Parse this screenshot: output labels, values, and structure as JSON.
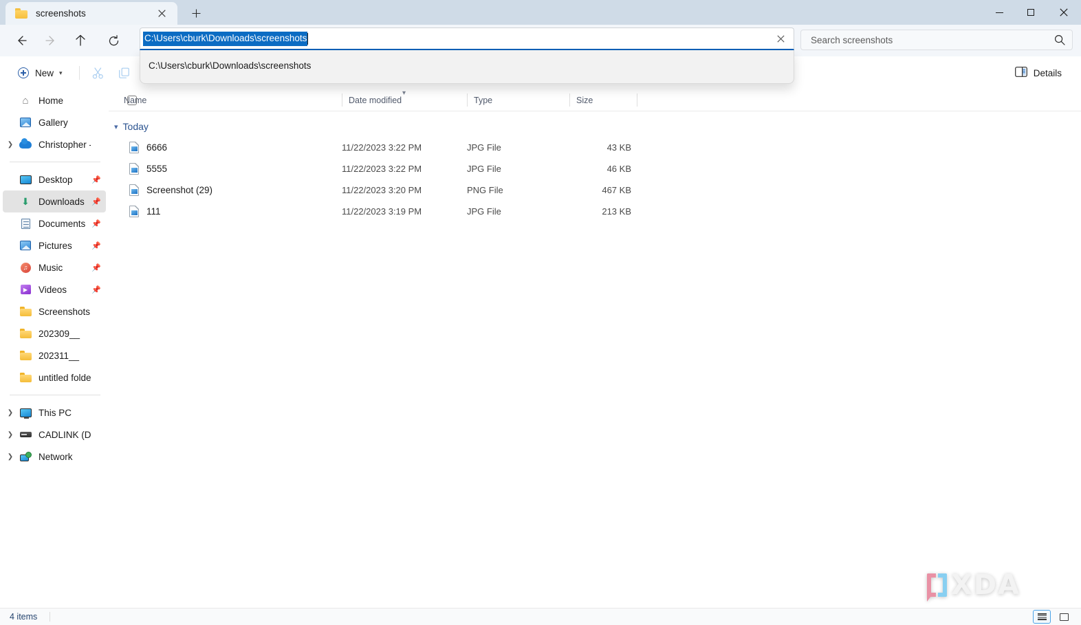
{
  "window": {
    "tab_title": "screenshots",
    "tab_close_icon": "close-icon",
    "new_tab_icon": "plus-icon",
    "minimize_icon": "minimize-icon",
    "maximize_icon": "maximize-icon",
    "close_icon": "close-icon"
  },
  "nav": {
    "back_icon": "arrow-left-icon",
    "forward_icon": "arrow-right-icon",
    "up_icon": "arrow-up-icon",
    "refresh_icon": "refresh-icon"
  },
  "address": {
    "value": "C:\\Users\\cburk\\Downloads\\screenshots",
    "selected": true,
    "clear_icon": "close-icon",
    "selection_color": "#0c6cc3",
    "underline_color": "#005fb8",
    "suggestions": [
      "C:\\Users\\cburk\\Downloads\\screenshots"
    ]
  },
  "search": {
    "placeholder": "Search screenshots",
    "icon": "search-icon"
  },
  "toolbar": {
    "new_label": "New",
    "new_icon": "plus-circle-icon",
    "new_chevron": "chevron-down-icon",
    "cut_icon": "scissors-icon",
    "copy_icon": "copy-icon",
    "details_label": "Details",
    "details_icon": "details-pane-icon"
  },
  "sidebar": {
    "items": [
      {
        "label": "Home",
        "icon": "home-icon",
        "type": "home",
        "expand": false,
        "pin": false,
        "selected": false
      },
      {
        "label": "Gallery",
        "icon": "gallery-icon",
        "type": "image",
        "expand": false,
        "pin": false,
        "selected": false
      },
      {
        "label": "Christopher - Perso",
        "icon": "onedrive-icon",
        "type": "cloud",
        "expand": true,
        "pin": false,
        "selected": false
      },
      {
        "separator": true
      },
      {
        "label": "Desktop",
        "icon": "desktop-icon",
        "type": "desktop",
        "expand": false,
        "pin": true,
        "selected": false
      },
      {
        "label": "Downloads",
        "icon": "downloads-icon",
        "type": "down",
        "expand": false,
        "pin": true,
        "selected": true
      },
      {
        "label": "Documents",
        "icon": "documents-icon",
        "type": "doc",
        "expand": false,
        "pin": true,
        "selected": false
      },
      {
        "label": "Pictures",
        "icon": "pictures-icon",
        "type": "image",
        "expand": false,
        "pin": true,
        "selected": false
      },
      {
        "label": "Music",
        "icon": "music-icon",
        "type": "music",
        "expand": false,
        "pin": true,
        "selected": false
      },
      {
        "label": "Videos",
        "icon": "videos-icon",
        "type": "video",
        "expand": false,
        "pin": true,
        "selected": false
      },
      {
        "label": "Screenshots",
        "icon": "folder-icon",
        "type": "folder",
        "expand": false,
        "pin": false,
        "selected": false
      },
      {
        "label": "202309__",
        "icon": "folder-icon",
        "type": "folder",
        "expand": false,
        "pin": false,
        "selected": false
      },
      {
        "label": "202311__",
        "icon": "folder-icon",
        "type": "folder",
        "expand": false,
        "pin": false,
        "selected": false
      },
      {
        "label": "untitled folder",
        "icon": "folder-icon",
        "type": "folder",
        "expand": false,
        "pin": false,
        "selected": false
      },
      {
        "separator": true
      },
      {
        "label": "This PC",
        "icon": "this-pc-icon",
        "type": "pc",
        "expand": true,
        "pin": false,
        "selected": false
      },
      {
        "label": "CADLINK (D:)",
        "icon": "drive-icon",
        "type": "drive",
        "expand": true,
        "pin": false,
        "selected": false
      },
      {
        "label": "Network",
        "icon": "network-icon",
        "type": "net",
        "expand": true,
        "pin": false,
        "selected": false
      }
    ]
  },
  "filelist": {
    "columns": {
      "name": "Name",
      "date_modified": "Date modified",
      "type": "Type",
      "size": "Size"
    },
    "sort_indicator": "chevron-down-icon",
    "group": {
      "label": "Today",
      "expanded": true
    },
    "rows": [
      {
        "name": "6666",
        "date": "11/22/2023 3:22 PM",
        "type": "JPG File",
        "size": "43 KB"
      },
      {
        "name": "5555",
        "date": "11/22/2023 3:22 PM",
        "type": "JPG File",
        "size": "46 KB"
      },
      {
        "name": "Screenshot (29)",
        "date": "11/22/2023 3:20 PM",
        "type": "PNG File",
        "size": "467 KB"
      },
      {
        "name": "111",
        "date": "11/22/2023 3:19 PM",
        "type": "JPG File",
        "size": "213 KB"
      }
    ]
  },
  "status": {
    "item_count": "4 items",
    "view_details_icon": "details-view-icon",
    "view_tiles_icon": "tiles-view-icon",
    "active_view": "details"
  },
  "watermark": {
    "text": "XDA",
    "bracket_left_color": "#e8889e",
    "bracket_right_color": "#7ecbf0"
  }
}
